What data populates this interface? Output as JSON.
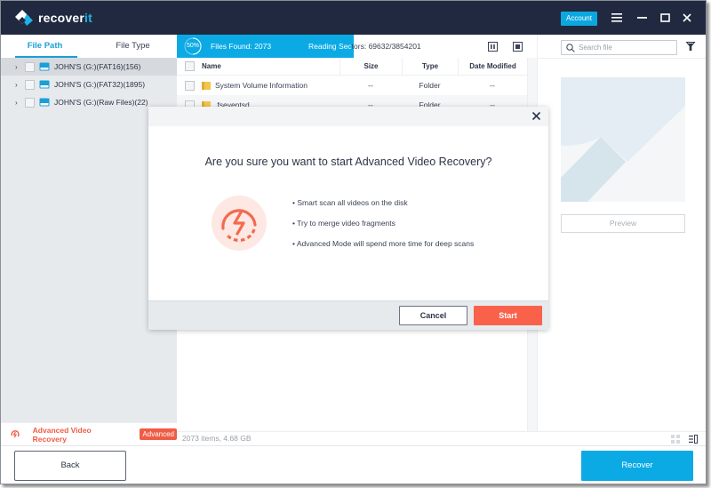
{
  "app": {
    "name_main": "recover",
    "name_accent": "it",
    "account_label": "Account",
    "window_controls": [
      "menu-icon",
      "minimize-icon",
      "maximize-icon",
      "close-icon"
    ]
  },
  "sidebar": {
    "tabs": [
      {
        "label": "File Path",
        "active": true
      },
      {
        "label": "File Type",
        "active": false
      }
    ],
    "tree": [
      {
        "label": "JOHN'S (G:)(FAT16)(156)",
        "selected": true
      },
      {
        "label": "JOHN'S (G:)(FAT32)(1895)",
        "selected": false
      },
      {
        "label": "JOHN'S (G:)(Raw Files)(22)",
        "selected": false
      }
    ],
    "advanced": {
      "label": "Advanced Video Recovery",
      "badge": "Advanced"
    }
  },
  "scan": {
    "progress_label": "50%",
    "progress": 0.5,
    "files_found": "Files Found:  2073",
    "reading_sectors_prefix": "Reading Sec",
    "reading_sectors_rest": "tors:  69632/3854201"
  },
  "filelist": {
    "columns": {
      "name": "Name",
      "size": "Size",
      "type": "Type",
      "date": "Date Modified"
    },
    "rows": [
      {
        "name": "System Volume Information",
        "size": "--",
        "type": "Folder",
        "date": "--"
      },
      {
        "name": ".fseventsd",
        "size": "--",
        "type": "Folder",
        "date": "--"
      }
    ],
    "status": "2073 items, 4.68  GB"
  },
  "right_panel": {
    "search_placeholder": "Search file",
    "preview_label": "Preview"
  },
  "bottom": {
    "back_label": "Back",
    "recover_label": "Recover"
  },
  "modal": {
    "title": "Are you sure you want to start Advanced Video Recovery?",
    "bullets": [
      "• Smart scan all videos on the disk",
      "• Try to merge video fragments",
      "• Advanced Mode will spend more time for deep scans"
    ],
    "cancel_label": "Cancel",
    "start_label": "Start"
  },
  "colors": {
    "titlebar": "#20293f",
    "accent_blue": "#0caae5",
    "accent_red": "#f9614b"
  }
}
